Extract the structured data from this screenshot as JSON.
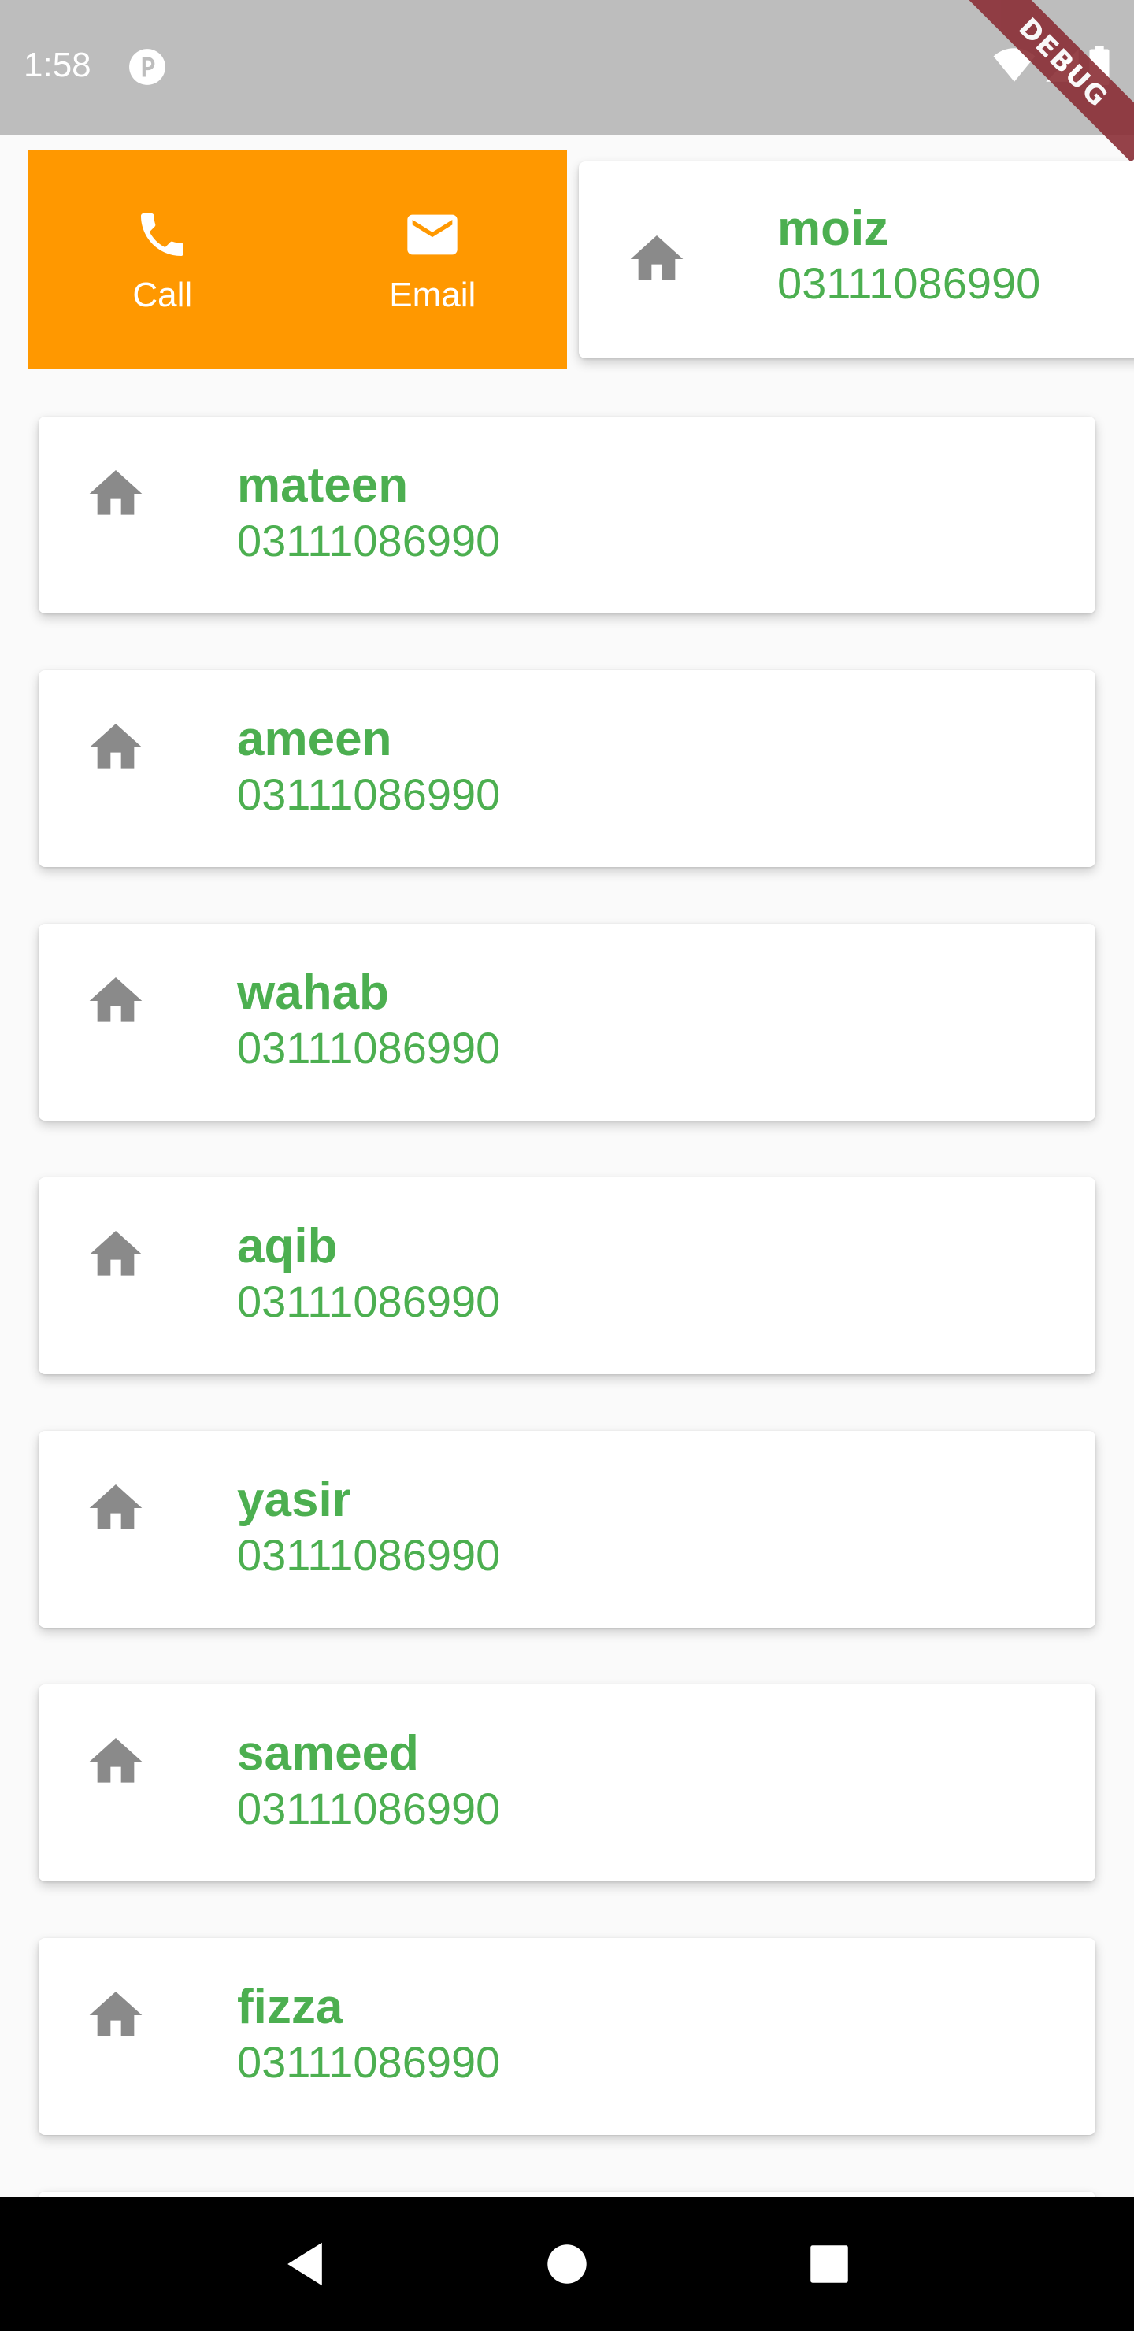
{
  "status_bar": {
    "time": "1:58",
    "debug_banner": "DEBUG"
  },
  "swiped_contact": {
    "actions": [
      {
        "label": "Call",
        "icon": "phone-icon"
      },
      {
        "label": "Email",
        "icon": "mail-icon"
      }
    ],
    "action_color": "#ff9800",
    "name": "moiz",
    "phone": "03111086990"
  },
  "contacts": [
    {
      "name": "mateen",
      "phone": "03111086990",
      "icon": "home-icon"
    },
    {
      "name": "ameen",
      "phone": "03111086990",
      "icon": "home-icon"
    },
    {
      "name": "wahab",
      "phone": "03111086990",
      "icon": "home-icon"
    },
    {
      "name": "aqib",
      "phone": "03111086990",
      "icon": "home-icon"
    },
    {
      "name": "yasir",
      "phone": "03111086990",
      "icon": "home-icon"
    },
    {
      "name": "sameed",
      "phone": "03111086990",
      "icon": "home-icon"
    },
    {
      "name": "fizza",
      "phone": "03111086990",
      "icon": "home-icon"
    }
  ],
  "colors": {
    "text_green": "#4caf50",
    "icon_grey": "#8a8a8a",
    "status_bar": "#bdbdbd"
  },
  "nav_bar": {
    "buttons": [
      "back-icon",
      "home-circle-icon",
      "recents-icon"
    ]
  }
}
